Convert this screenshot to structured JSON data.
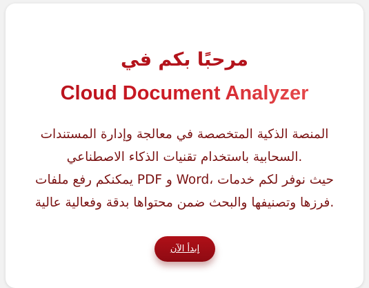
{
  "welcome": {
    "greeting": "مرحبًا بكم في",
    "app_name": "Cloud Document Analyzer",
    "description_lines": [
      "المنصة الذكية المتخصصة في معالجة وإدارة المستندات",
      ".السحابية باستخدام تقنيات الذكاء الاصطناعي",
      "حيث نوفر لكم خدمات ،Word و PDF يمكنكم رفع ملفات",
      ".فرزها وتصنيفها والبحث ضمن محتواها بدقة وفعالية عالية"
    ],
    "start_button": "إبدأ الآن"
  },
  "colors": {
    "accent": "#b3131b",
    "text": "#7a1212",
    "background": "#ffffff"
  }
}
